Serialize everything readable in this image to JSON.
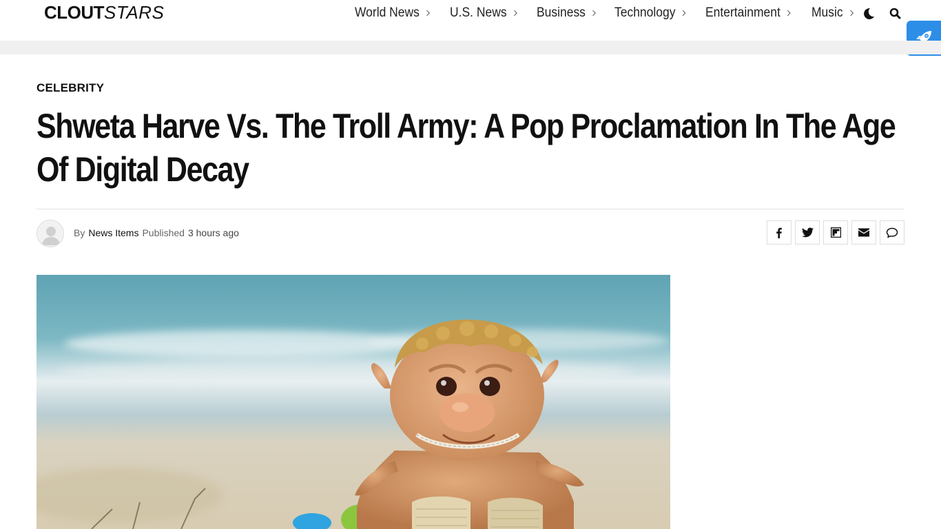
{
  "header": {
    "logo_part1": "CLOUT",
    "logo_part2": "STARS",
    "nav": [
      {
        "label": "World News"
      },
      {
        "label": "U.S. News"
      },
      {
        "label": "Business"
      },
      {
        "label": "Technology"
      },
      {
        "label": "Entertainment"
      },
      {
        "label": "Music"
      }
    ],
    "icons": [
      "moon-icon",
      "search-icon",
      "rocket-icon"
    ]
  },
  "article": {
    "category": "CELEBRITY",
    "title": "Shweta Harve Vs. The Troll Army: A Pop Proclamation In The Age Of Digital Decay",
    "byline": {
      "by_label": "By",
      "author": "News Items",
      "published_label": "Published",
      "time": "3 hours ago"
    },
    "share_icons": [
      "facebook-icon",
      "twitter-icon",
      "flipboard-icon",
      "email-icon",
      "comment-icon"
    ]
  },
  "colors": {
    "rocket_button": "#2d8ee8",
    "header_band": "#f0f0f0",
    "text": "#111111"
  }
}
